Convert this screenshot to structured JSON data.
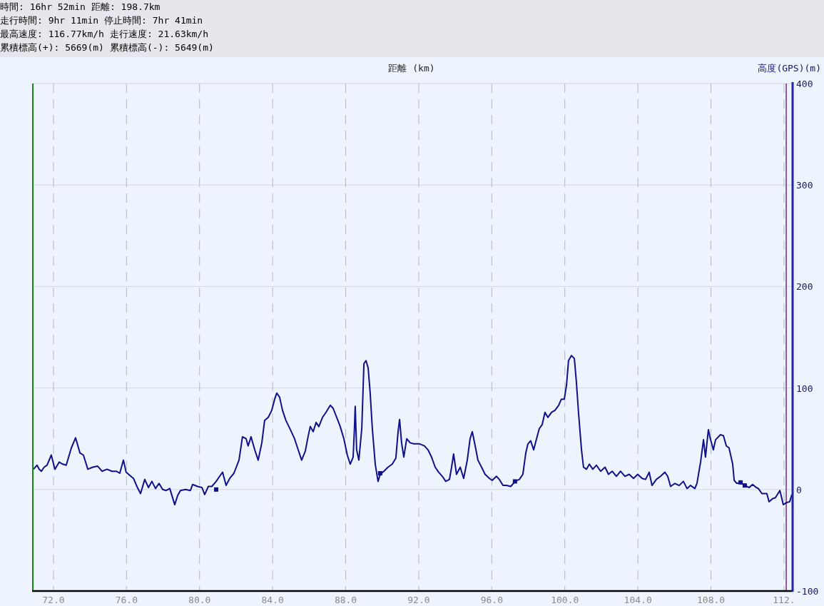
{
  "summary": {
    "lines": [
      [
        "時間: 16hr 52min",
        "距離: 198.7km"
      ],
      [
        "走行時間: 9hr 11min",
        "停止時間: 7hr 41min"
      ],
      [
        "最高速度: 116.77km/h",
        "走行速度: 21.63km/h"
      ],
      [
        "累積標高(+): 5669(m)",
        "累積標高(-): 5649(m)"
      ]
    ]
  },
  "chart": {
    "chart_data": {
      "type": "line",
      "xlabel": "距離 (km)",
      "ylabel": "高度(GPS)(m)",
      "x": [
        70.91,
        71.1,
        71.22,
        71.34,
        71.49,
        71.65,
        71.88,
        72.08,
        72.31,
        72.51,
        72.7,
        72.98,
        73.21,
        73.45,
        73.64,
        73.88,
        74.15,
        74.42,
        74.66,
        74.93,
        75.2,
        75.44,
        75.63,
        75.83,
        75.98,
        76.18,
        76.38,
        76.57,
        76.77,
        77.0,
        77.2,
        77.39,
        77.59,
        77.78,
        77.98,
        78.17,
        78.37,
        78.64,
        78.8,
        78.95,
        79.23,
        79.5,
        79.62,
        79.89,
        80.13,
        80.28,
        80.48,
        80.67,
        80.91,
        81.1,
        81.26,
        81.45,
        81.65,
        81.88,
        82.16,
        82.35,
        82.55,
        82.66,
        82.82,
        83.02,
        83.21,
        83.41,
        83.56,
        83.76,
        83.95,
        84.11,
        84.23,
        84.38,
        84.54,
        84.73,
        84.97,
        85.2,
        85.4,
        85.59,
        85.79,
        85.95,
        86.06,
        86.22,
        86.38,
        86.53,
        86.73,
        86.92,
        87.16,
        87.31,
        87.51,
        87.7,
        87.9,
        88.09,
        88.25,
        88.41,
        88.48,
        88.52,
        88.6,
        88.72,
        88.88,
        89.0,
        89.11,
        89.23,
        89.34,
        89.46,
        89.62,
        89.77,
        89.89,
        90.09,
        90.32,
        90.55,
        90.75,
        90.87,
        90.95,
        91.06,
        91.18,
        91.34,
        91.53,
        91.73,
        92.04,
        92.31,
        92.51,
        92.7,
        92.9,
        93.09,
        93.29,
        93.48,
        93.68,
        93.8,
        93.91,
        94.07,
        94.27,
        94.46,
        94.66,
        94.81,
        94.93,
        95.09,
        95.24,
        95.44,
        95.63,
        95.87,
        96.02,
        96.25,
        96.41,
        96.61,
        96.8,
        97.04,
        97.27,
        97.51,
        97.7,
        97.86,
        97.98,
        98.13,
        98.29,
        98.45,
        98.6,
        98.76,
        98.91,
        99.07,
        99.27,
        99.46,
        99.66,
        99.81,
        99.97,
        100.09,
        100.2,
        100.36,
        100.52,
        100.63,
        100.75,
        100.91,
        101.02,
        101.18,
        101.34,
        101.53,
        101.73,
        101.96,
        102.2,
        102.39,
        102.59,
        102.82,
        103.05,
        103.29,
        103.52,
        103.76,
        103.99,
        104.23,
        104.42,
        104.62,
        104.77,
        105.01,
        105.24,
        105.48,
        105.63,
        105.79,
        106.02,
        106.26,
        106.49,
        106.69,
        106.88,
        107.12,
        107.23,
        107.43,
        107.59,
        107.7,
        107.82,
        107.86,
        107.94,
        108.13,
        108.25,
        108.52,
        108.68,
        108.84,
        108.99,
        109.19,
        109.27,
        109.42,
        109.62,
        109.85,
        110.09,
        110.28,
        110.48,
        110.59,
        110.79,
        111.06,
        111.18,
        111.38,
        111.53,
        111.77,
        111.84,
        111.96,
        112.12,
        112.31,
        112.43
      ],
      "series": [
        {
          "color": "#10108a",
          "values": [
            20,
            24,
            20,
            18,
            22,
            24,
            34,
            20,
            27,
            25,
            24,
            41,
            51,
            36,
            34,
            20,
            22,
            23,
            18,
            20,
            18,
            18,
            16,
            29,
            17,
            14,
            11,
            3,
            -4,
            10,
            2,
            8,
            1,
            6,
            0,
            -1,
            1,
            -15,
            -6,
            -1,
            0,
            -1,
            5,
            3,
            2,
            -5,
            3,
            3,
            8,
            13,
            17,
            4,
            11,
            16,
            29,
            52,
            50,
            43,
            52,
            39,
            29,
            46,
            68,
            71,
            78,
            89,
            95,
            91,
            78,
            68,
            59,
            50,
            39,
            29,
            38,
            53,
            62,
            57,
            66,
            62,
            71,
            76,
            83,
            80,
            71,
            62,
            50,
            34,
            25,
            32,
            60,
            82,
            39,
            29,
            60,
            124,
            127,
            120,
            96,
            60,
            25,
            8,
            15,
            18,
            22,
            25,
            31,
            57,
            69,
            46,
            32,
            50,
            46,
            45,
            45,
            43,
            39,
            32,
            22,
            17,
            13,
            8,
            10,
            22,
            35,
            15,
            22,
            11,
            29,
            50,
            57,
            43,
            29,
            22,
            15,
            11,
            9,
            13,
            10,
            4,
            4,
            3,
            8,
            10,
            15,
            36,
            45,
            48,
            39,
            50,
            60,
            64,
            76,
            71,
            76,
            78,
            83,
            89,
            89,
            103,
            127,
            132,
            129,
            106,
            75,
            39,
            22,
            20,
            25,
            20,
            24,
            18,
            22,
            15,
            18,
            13,
            18,
            13,
            15,
            11,
            15,
            11,
            10,
            17,
            4,
            10,
            13,
            17,
            13,
            3,
            6,
            4,
            8,
            1,
            4,
            1,
            6,
            27,
            49,
            32,
            53,
            59,
            52,
            39,
            49,
            54,
            53,
            43,
            41,
            25,
            9,
            6,
            7,
            4,
            2,
            5,
            2,
            1,
            -4,
            -4,
            -12,
            -9,
            -8,
            -1,
            -6,
            -15,
            -13,
            -12,
            -5
          ]
        },
        {
          "type": "scatter",
          "color": "#10108a",
          "marker": "square",
          "values": [
            null,
            null,
            null,
            null,
            null,
            null,
            null,
            null,
            null,
            null,
            null,
            null,
            null,
            null,
            null,
            null,
            null,
            null,
            null,
            null,
            null,
            null,
            null,
            null,
            null,
            null,
            null,
            null,
            null,
            null,
            null,
            null,
            null,
            null,
            null,
            null,
            null,
            null,
            null,
            null,
            null,
            null,
            null,
            null,
            null,
            null,
            null,
            null,
            0,
            null,
            null,
            null,
            null,
            null,
            null,
            null,
            null,
            null,
            null,
            null,
            null,
            null,
            null,
            null,
            null,
            null,
            null,
            null,
            null,
            null,
            null,
            null,
            null,
            null,
            null,
            null,
            null,
            null,
            null,
            null,
            null,
            null,
            null,
            null,
            null,
            null,
            null,
            null,
            null,
            null,
            null,
            null,
            null,
            null,
            null,
            null,
            null,
            null,
            null,
            null,
            null,
            null,
            16,
            null,
            null,
            null,
            null,
            null,
            null,
            null,
            null,
            null,
            null,
            null,
            null,
            null,
            null,
            null,
            null,
            null,
            null,
            null,
            null,
            null,
            null,
            null,
            null,
            null,
            null,
            null,
            null,
            null,
            null,
            null,
            null,
            null,
            null,
            null,
            null,
            null,
            null,
            null,
            8,
            null,
            null,
            null,
            null,
            null,
            null,
            null,
            null,
            null,
            null,
            null,
            null,
            null,
            null,
            null,
            null,
            null,
            null,
            null,
            null,
            null,
            null,
            null,
            null,
            null,
            null,
            null,
            null,
            null,
            null,
            null,
            null,
            null,
            null,
            null,
            null,
            null,
            null,
            null,
            null,
            null,
            null,
            null,
            null,
            null,
            null,
            null,
            null,
            null,
            null,
            null,
            null,
            null,
            null,
            null,
            null,
            null,
            null,
            null,
            null,
            null,
            null,
            null,
            null,
            null,
            null,
            null,
            null,
            null,
            7,
            4,
            null,
            null,
            null,
            null,
            null,
            null,
            null,
            null,
            null,
            null,
            null,
            null,
            null,
            null,
            null
          ]
        }
      ],
      "xlim": [
        70.87,
        112.47
      ],
      "ylim": [
        -100,
        400
      ],
      "grid": true,
      "xticks": [
        {
          "value": 72,
          "label": "72.0"
        },
        {
          "value": 76,
          "label": "76.0"
        },
        {
          "value": 80,
          "label": "80.0"
        },
        {
          "value": 84,
          "label": "84.0"
        },
        {
          "value": 88,
          "label": "88.0"
        },
        {
          "value": 92,
          "label": "92.0"
        },
        {
          "value": 96,
          "label": "96.0"
        },
        {
          "value": 100,
          "label": "100.0"
        },
        {
          "value": 104,
          "label": "104.0"
        },
        {
          "value": 108,
          "label": "108.0"
        },
        {
          "value": 112,
          "label": "112."
        }
      ],
      "yticks": [
        400,
        300,
        200,
        100,
        0,
        -100
      ],
      "ref_lines": [
        {
          "axis": "x",
          "value": 112.12,
          "color": "#7a2a7a"
        }
      ]
    }
  }
}
